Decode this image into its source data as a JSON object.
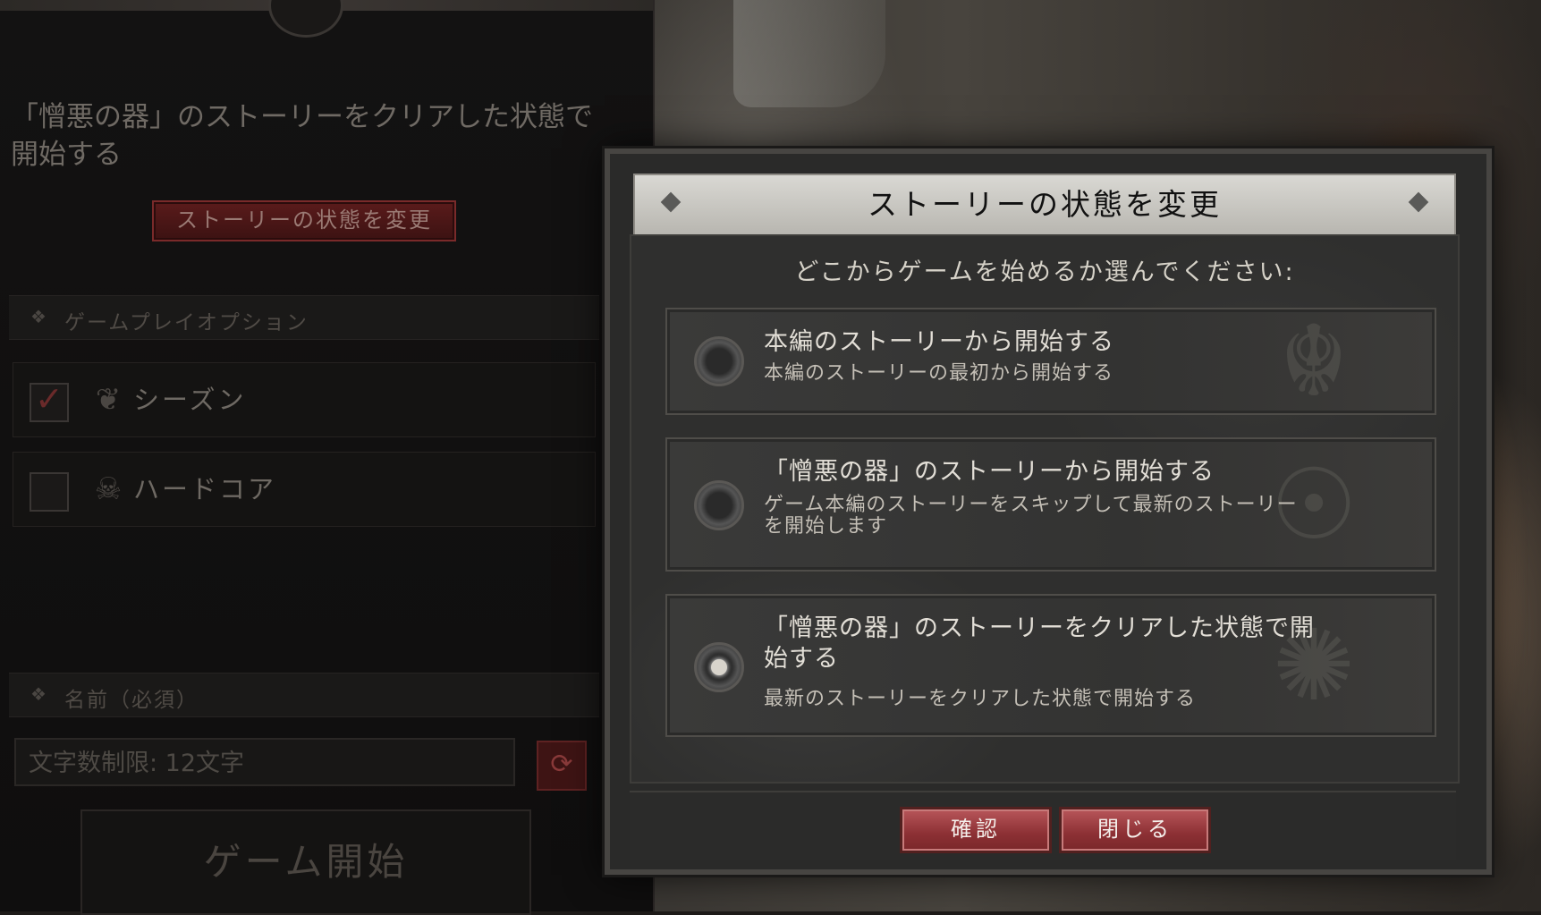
{
  "left_panel": {
    "story_description": "「憎悪の器」のストーリーをクリアした状態で開始する",
    "change_story_button": "ストーリーの状態を変更",
    "gameplay_options_header": "ゲームプレイオプション",
    "options": [
      {
        "label": "シーズン",
        "checked": true,
        "icon": "leaf-icon"
      },
      {
        "label": "ハードコア",
        "checked": false,
        "icon": "hooded-skull-icon"
      }
    ],
    "name_header": "名前（必須）",
    "name_placeholder": "文字数制限: 12文字",
    "start_button": "ゲーム開始"
  },
  "modal": {
    "title": "ストーリーの状態を変更",
    "prompt": "どこからゲームを始めるか選んでください:",
    "choices": [
      {
        "title": "本編のストーリーから開始する",
        "subtitle": "本編のストーリーの最初から開始する",
        "selected": false
      },
      {
        "title": "「憎悪の器」のストーリーから開始する",
        "subtitle": "ゲーム本編のストーリーをスキップして最新のストーリーを開始します",
        "selected": false
      },
      {
        "title": "「憎悪の器」のストーリーをクリアした状態で開始する",
        "subtitle": "最新のストーリーをクリアした状態で開始する",
        "selected": true
      }
    ],
    "confirm_button": "確認",
    "close_button": "閉じる"
  },
  "colors": {
    "accent_red": "#8c3034",
    "title_bar": "#d0cfc9",
    "modal_bg": "#2f2f2e"
  }
}
